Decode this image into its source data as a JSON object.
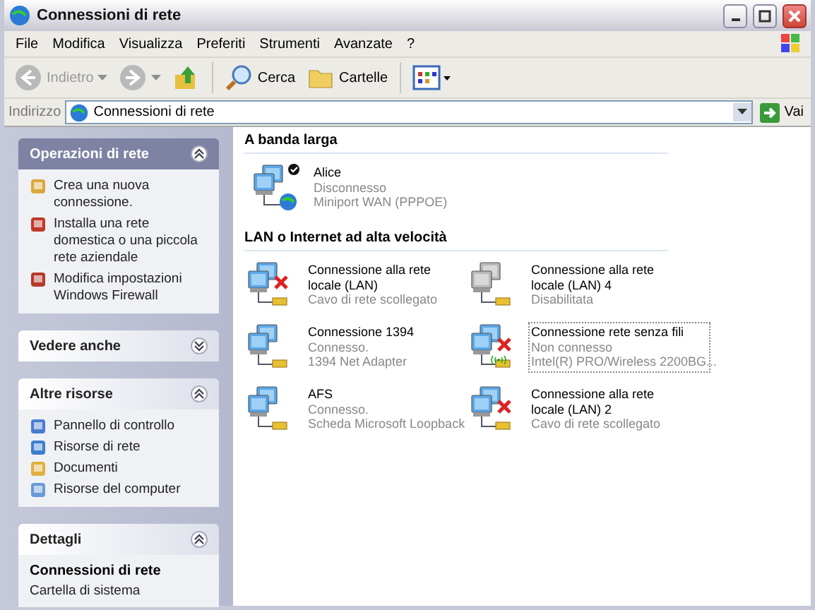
{
  "window": {
    "title": "Connessioni di rete"
  },
  "menu": [
    "File",
    "Modifica",
    "Visualizza",
    "Preferiti",
    "Strumenti",
    "Avanzate",
    "?"
  ],
  "toolbar": [
    {
      "kind": "back",
      "label": "Indietro",
      "disabled": true
    },
    {
      "kind": "forward",
      "disabled": true
    },
    {
      "kind": "up"
    },
    {
      "kind": "search",
      "label": "Cerca"
    },
    {
      "kind": "folders",
      "label": "Cartelle"
    },
    {
      "kind": "views"
    }
  ],
  "address": {
    "label": "Indirizzo",
    "value": "Connessioni di rete",
    "go": "Vai"
  },
  "sidebar": [
    {
      "kind": "special",
      "title": "Operazioni di rete",
      "expanded": true,
      "items": [
        {
          "label": "Crea una nuova connessione."
        },
        {
          "label": "Installa una rete domestica o una piccola rete aziendale"
        },
        {
          "label": "Modifica impostazioni Windows Firewall"
        }
      ]
    },
    {
      "kind": "normal",
      "title": "Vedere anche",
      "expanded": false
    },
    {
      "kind": "normal",
      "title": "Altre risorse",
      "expanded": true,
      "items": [
        {
          "label": "Pannello di controllo"
        },
        {
          "label": "Risorse di rete"
        },
        {
          "label": "Documenti"
        },
        {
          "label": "Risorse del computer"
        }
      ]
    },
    {
      "kind": "details",
      "title": "Dettagli",
      "expanded": true,
      "name": "Connessioni di rete",
      "type": "Cartella di sistema"
    }
  ],
  "groups": [
    {
      "title": "A banda larga",
      "items": [
        {
          "kind": "broadband",
          "name": "Alice",
          "status": "Disconnesso",
          "device": "Miniport WAN (PPPOE)",
          "default": true,
          "error": false,
          "disabled": false,
          "selected": false
        }
      ]
    },
    {
      "title": "LAN o Internet ad alta velocità",
      "items": [
        {
          "kind": "lan",
          "name": "Connessione alla rete locale (LAN)",
          "status": "Cavo di rete scollegato",
          "error": true,
          "disabled": false,
          "selected": false
        },
        {
          "kind": "lan",
          "name": "Connessione alla rete locale (LAN) 4",
          "status": "Disabilitata",
          "error": false,
          "disabled": true,
          "selected": false
        },
        {
          "kind": "lan",
          "name": "Connessione 1394",
          "status": "Connesso.",
          "device": "1394 Net Adapter",
          "error": false,
          "disabled": false,
          "selected": false
        },
        {
          "kind": "wireless",
          "name": "Connessione rete senza fili",
          "status": "Non connesso",
          "device": "Intel(R) PRO/Wireless 2200BG...",
          "error": true,
          "disabled": false,
          "selected": true
        },
        {
          "kind": "lan",
          "name": "AFS",
          "status": "Connesso.",
          "device": "Scheda Microsoft Loopback",
          "error": false,
          "disabled": false,
          "selected": false
        },
        {
          "kind": "lan",
          "name": "Connessione alla rete locale (LAN) 2",
          "status": "Cavo di rete scollegato",
          "error": true,
          "disabled": false,
          "selected": false
        }
      ]
    }
  ]
}
